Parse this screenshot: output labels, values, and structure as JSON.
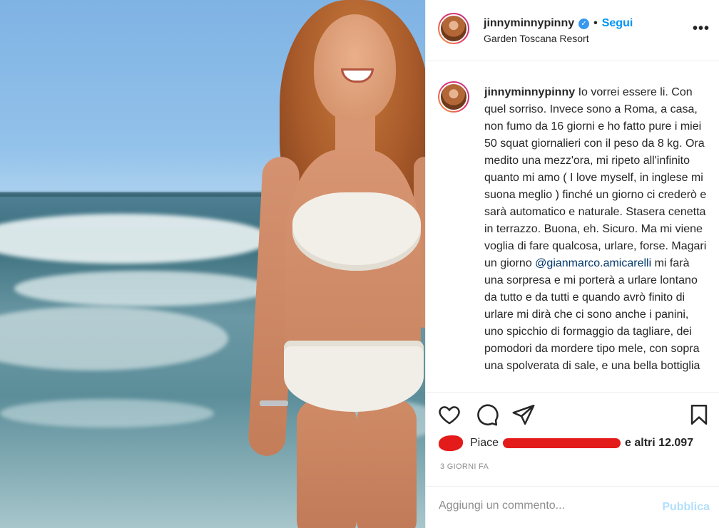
{
  "post": {
    "username": "jinnyminnypinny",
    "verified_mark": "✓",
    "dot": "•",
    "follow_label": "Segui",
    "location": "Garden Toscana Resort",
    "more_label": "•••",
    "image_icon": "photo"
  },
  "caption": {
    "username": "jinnyminnypinny",
    "text_before_mention": " Io vorrei essere li. Con quel sorriso. Invece sono a Roma, a casa, non fumo da 16 giorni e ho fatto pure i miei 50 squat giornalieri con il peso da 8 kg. Ora medito una mezz'ora, mi ripeto all'infinito quanto mi amo ( I love myself, in inglese mi suona meglio ) finché un giorno ci crederò e sarà automatico e naturale. Stasera cenetta in terrazzo. Buona, eh. Sicuro. Ma mi viene voglia di fare qualcosa, urlare, forse. Magari un giorno ",
    "mention": "@gianmarco.amicarelli",
    "text_after_mention": " mi farà una sorpresa e mi porterà a urlare lontano da tutto e da tutti e quando avrò finito di urlare mi dirà che ci sono anche i panini, uno spicchio di formaggio da tagliare, dei pomodori da mordere tipo mele, con sopra una spolverata di sale, e una bella bottiglia"
  },
  "actions": {
    "icons": [
      "heart-icon",
      "comment-icon",
      "share-icon",
      "bookmark-icon"
    ]
  },
  "likes": {
    "prefix": "Piace",
    "others_label": "e altri 12.097"
  },
  "time_label": "3 GIORNI FA",
  "comment_box": {
    "placeholder": "Aggiungi un commento...",
    "publish_label": "Pubblica"
  },
  "colors": {
    "accent": "#0095f6",
    "mention": "#00376b",
    "publish_disabled": "#b2dffc",
    "redaction": "#e41b1b"
  }
}
